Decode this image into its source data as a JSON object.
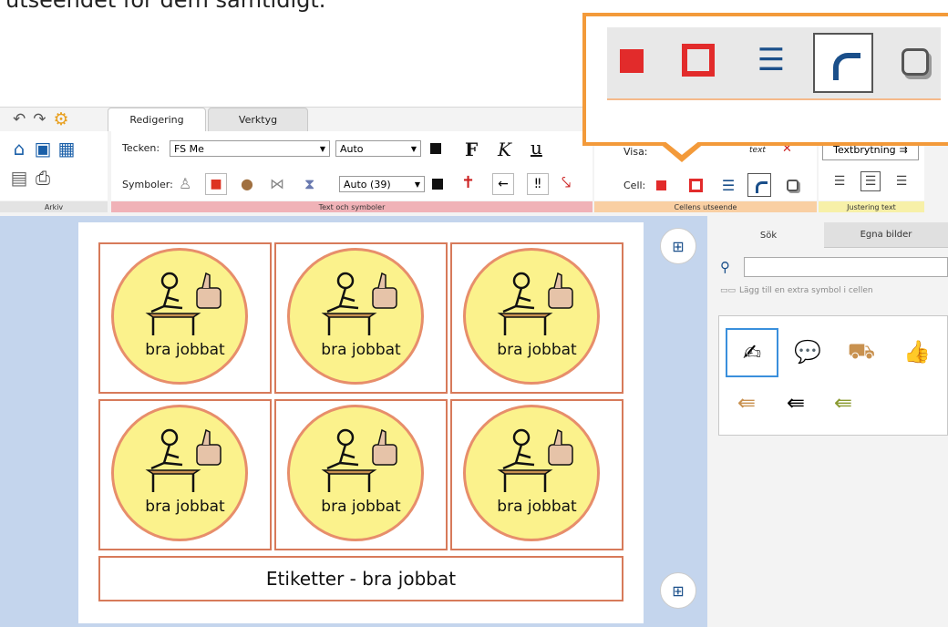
{
  "intro": "utseendet för dem samtidigt.",
  "tabs": {
    "active": "Redigering",
    "inactive": "Verktyg"
  },
  "groups": {
    "arkiv": "Arkiv",
    "text_symbols": "Text och symboler",
    "cell_appearance": "Cellens utseende",
    "justify": "Justering text"
  },
  "text_group": {
    "font_label": "Tecken:",
    "font_value": "FS Me",
    "size_value": "Auto",
    "bold": "F",
    "italic": "K",
    "underline": "u",
    "symbols_label": "Symboler:",
    "symbol_size_value": "Auto (39)"
  },
  "cell_group": {
    "visa_label": "Visa:",
    "cell_label": "Cell:",
    "text_icon_label": "text"
  },
  "justify_group": {
    "textbrytning": "Textbrytning"
  },
  "canvas": {
    "cells": [
      {
        "label": "bra jobbat"
      },
      {
        "label": "bra jobbat"
      },
      {
        "label": "bra jobbat"
      },
      {
        "label": "bra jobbat"
      },
      {
        "label": "bra jobbat"
      },
      {
        "label": "bra jobbat"
      }
    ],
    "footer": "Etiketter - bra jobbat"
  },
  "side_panel": {
    "tab_search": "Sök",
    "tab_own": "Egna bilder",
    "search_value": "",
    "extra_symbol": "Lägg till en extra symbol i cellen"
  },
  "colors": {
    "accent_orange": "#f39a3a",
    "cell_border": "#d77a5a",
    "circle_fill": "#fbf28c",
    "red": "#e22b2b",
    "blue": "#1a4f8a"
  }
}
